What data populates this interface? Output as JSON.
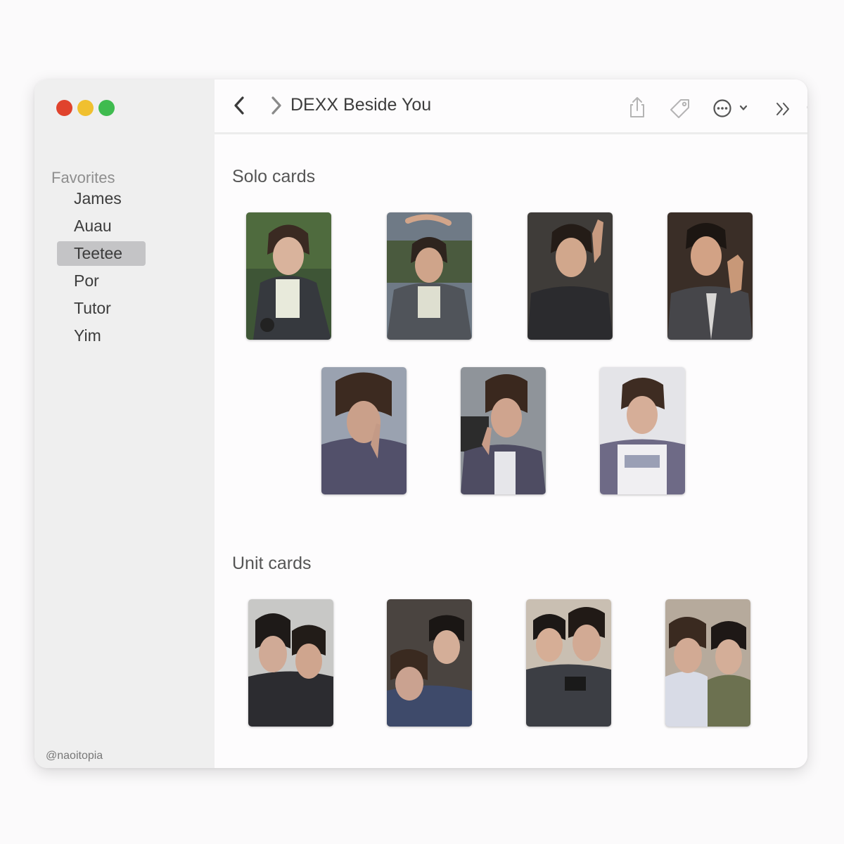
{
  "window": {
    "title": "DEXX Beside You"
  },
  "sidebar": {
    "section_title": "Favorites",
    "items": [
      {
        "label": "James",
        "selected": false
      },
      {
        "label": "Auau",
        "selected": false
      },
      {
        "label": "Teetee",
        "selected": true
      },
      {
        "label": "Por",
        "selected": false
      },
      {
        "label": "Tutor",
        "selected": false
      },
      {
        "label": "Yim",
        "selected": false
      }
    ],
    "watermark": "@naoitopia"
  },
  "toolbar": {
    "back_icon": "chevron-left-icon",
    "forward_icon": "chevron-right-icon",
    "share_icon": "share-icon",
    "tag_icon": "tag-icon",
    "more_icon": "ellipsis-circle-icon",
    "overflow_icon": "double-chevron-right-icon",
    "search_icon": "search-icon"
  },
  "sections": {
    "solo": {
      "title": "Solo cards",
      "count": 7
    },
    "unit": {
      "title": "Unit cards",
      "count": 4
    }
  },
  "colors": {
    "traffic_red": "#e0432d",
    "traffic_yellow": "#f0c02f",
    "traffic_green": "#3fbb4f",
    "selection": "#c4c4c6"
  }
}
